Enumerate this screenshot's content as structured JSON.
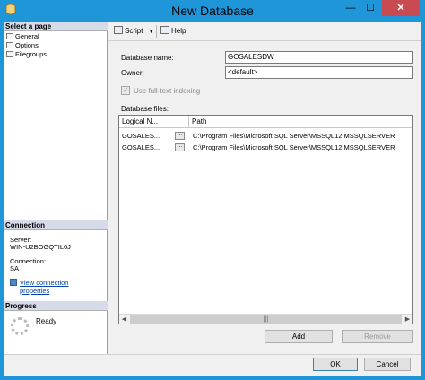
{
  "window": {
    "title": "New Database",
    "minimize_glyph": "—",
    "maximize_glyph": "☐",
    "close_glyph": "✕"
  },
  "left": {
    "select_page_header": "Select a page",
    "pages": [
      {
        "label": "General",
        "icon": "page-icon"
      },
      {
        "label": "Options",
        "icon": "page-icon"
      },
      {
        "label": "Filegroups",
        "icon": "page-icon"
      }
    ],
    "connection_header": "Connection",
    "server_label": "Server:",
    "server_value": "WIN-U2BOGQTIL6J",
    "connection_label": "Connection:",
    "connection_value": "SA",
    "view_link_line1": "View connection",
    "view_link_line2": "properties",
    "progress_header": "Progress",
    "progress_status": "Ready"
  },
  "toolbar": {
    "script_label": "Script",
    "script_arrow": "▼",
    "help_label": "Help"
  },
  "form": {
    "db_name_label": "Database name:",
    "db_name_value": "GOSALESDW",
    "owner_label": "Owner:",
    "owner_value": "<default>",
    "owner_browse": "...",
    "fulltext_label": "Use full-text indexing",
    "fulltext_checked": true,
    "check_glyph": "✓",
    "files_label": "Database files:"
  },
  "grid": {
    "columns": [
      "Logical N...",
      "Path"
    ],
    "rows": [
      {
        "logical": "GOSALES...",
        "browse": "...",
        "path": "C:\\Program Files\\Microsoft SQL Server\\MSSQL12.MSSQLSERVER"
      },
      {
        "logical": "GOSALES...",
        "browse": "...",
        "path": "C:\\Program Files\\Microsoft SQL Server\\MSSQL12.MSSQLSERVER"
      }
    ],
    "scroll_left": "◀",
    "scroll_right": "▶",
    "scroll_grip": "|||"
  },
  "buttons": {
    "add": "Add",
    "remove": "Remove",
    "ok": "OK",
    "cancel": "Cancel"
  },
  "colors": {
    "title_bar": "#1e96d8",
    "close_button": "#c74b50",
    "section_header": "#d6dbe9",
    "link": "#0645ad"
  }
}
